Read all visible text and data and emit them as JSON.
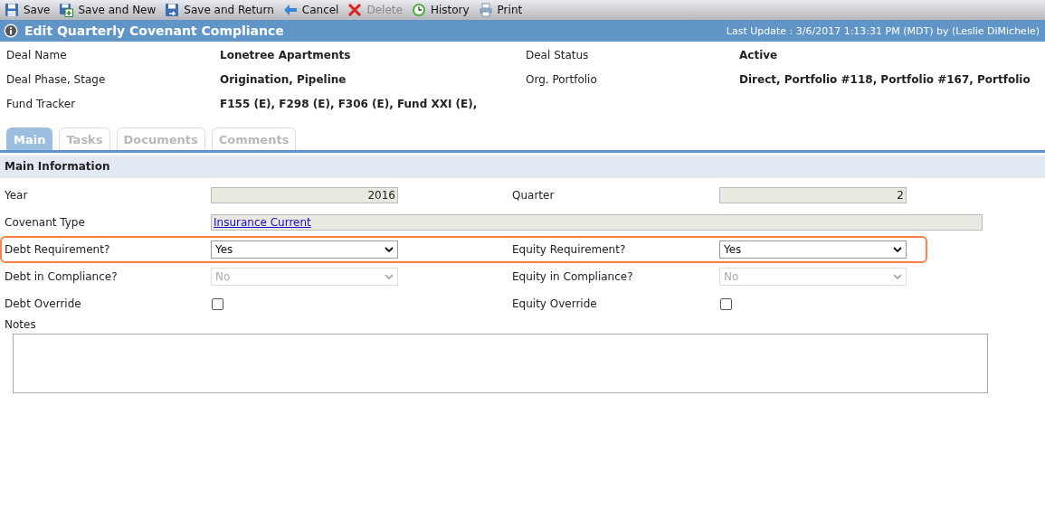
{
  "toolbar": [
    {
      "label": "Save",
      "kind": "save",
      "disabled": false
    },
    {
      "label": "Save and New",
      "kind": "new",
      "disabled": false
    },
    {
      "label": "Save and Return",
      "kind": "return",
      "disabled": false
    },
    {
      "label": "Cancel",
      "kind": "cancel",
      "disabled": false
    },
    {
      "label": "Delete",
      "kind": "delete",
      "disabled": true
    },
    {
      "label": "History",
      "kind": "history",
      "disabled": false
    },
    {
      "label": "Print",
      "kind": "print",
      "disabled": false
    }
  ],
  "header": {
    "title": "Edit Quarterly Covenant Compliance",
    "last_update": "Last Update : 3/6/2017 1:13:31 PM (MDT) by (Leslie DiMichele)"
  },
  "deal_info": [
    [
      {
        "label": "Deal Name",
        "value": "Lonetree Apartments"
      },
      {
        "label": "Deal Status",
        "value": "Active"
      }
    ],
    [
      {
        "label": "Deal Phase, Stage",
        "value": "Origination, Pipeline"
      },
      {
        "label": "Org. Portfolio",
        "value": "Direct, Portfolio #118, Portfolio #167, Portfolio"
      }
    ],
    [
      {
        "label": "Fund Tracker",
        "value": "F155 (E), F298 (E), F306 (E), Fund XXI (E),"
      }
    ]
  ],
  "tabs": [
    {
      "label": "Main",
      "selected": true
    },
    {
      "label": "Tasks",
      "selected": false
    },
    {
      "label": "Documents",
      "selected": false
    },
    {
      "label": "Comments",
      "selected": false
    }
  ],
  "section": {
    "title": "Main Information"
  },
  "form_rows": [
    {
      "highlighted": false,
      "cells": [
        {
          "label": "Year",
          "field": {
            "kind": "number",
            "value": "2016"
          }
        },
        {
          "label": "Quarter",
          "field": {
            "kind": "number",
            "value": "2"
          }
        }
      ]
    },
    {
      "highlighted": false,
      "cells": [
        {
          "label": "Covenant Type",
          "field": {
            "kind": "link",
            "value": "Insurance Current"
          }
        }
      ]
    },
    {
      "highlighted": true,
      "cells": [
        {
          "label": "Debt Requirement?",
          "field": {
            "kind": "select",
            "value": "Yes",
            "disabled": false
          }
        },
        {
          "label": "Equity Requirement?",
          "field": {
            "kind": "select",
            "value": "Yes",
            "disabled": false
          }
        }
      ]
    },
    {
      "highlighted": false,
      "cells": [
        {
          "label": "Debt in Compliance?",
          "field": {
            "kind": "select",
            "value": "No",
            "disabled": true
          }
        },
        {
          "label": "Equity in Compliance?",
          "field": {
            "kind": "select",
            "value": "No",
            "disabled": true
          }
        }
      ]
    },
    {
      "highlighted": false,
      "cells": [
        {
          "label": "Debt Override",
          "field": {
            "kind": "checkbox",
            "checked": false
          }
        },
        {
          "label": "Equity Override",
          "field": {
            "kind": "checkbox",
            "checked": false
          }
        }
      ]
    }
  ],
  "notes": {
    "label": "Notes"
  }
}
